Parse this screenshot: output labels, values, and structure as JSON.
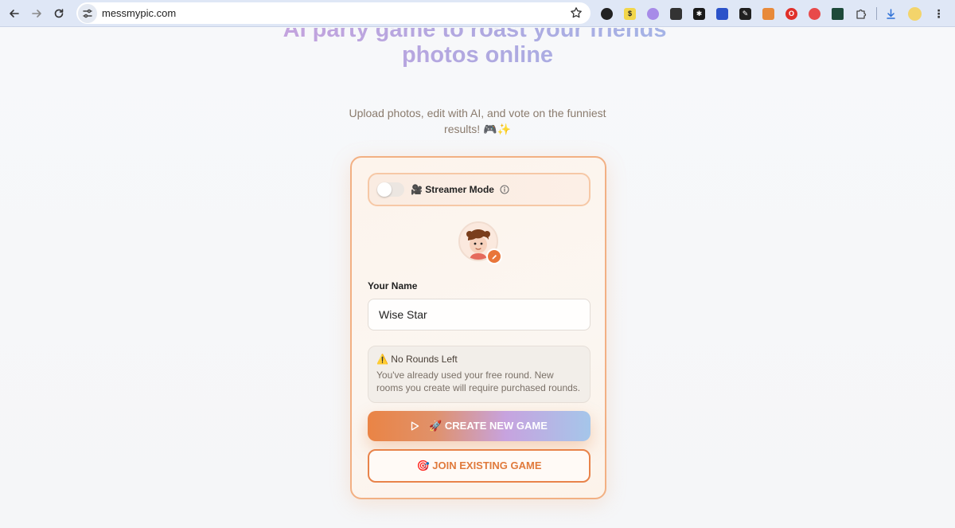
{
  "browser": {
    "url": "messmypic.com",
    "extensions": [
      {
        "icon": "ext-dark-circle-icon",
        "color": "#222222"
      },
      {
        "icon": "ext-dollar-icon",
        "color": "#f2d64b"
      },
      {
        "icon": "ext-cloud-icon",
        "color": "#a78be8"
      },
      {
        "icon": "ext-gift-icon",
        "color": "#333333"
      },
      {
        "icon": "ext-star-icon",
        "color": "#1a1a1a"
      },
      {
        "icon": "ext-blue-box-icon",
        "color": "#2b52c9"
      },
      {
        "icon": "ext-pencil-icon",
        "color": "#202020"
      },
      {
        "icon": "ext-fox-icon",
        "color": "#e88a3a"
      },
      {
        "icon": "ext-opera-icon",
        "color": "#e0302a"
      },
      {
        "icon": "ext-record-icon",
        "color": "#e84a4a"
      },
      {
        "icon": "ext-green-square-icon",
        "color": "#1e4a3a"
      },
      {
        "icon": "puzzle-icon",
        "color": "#444444"
      }
    ]
  },
  "hero": {
    "title": "AI party game to roast your friends' photos online",
    "subtitle": "Upload photos, edit with AI, and vote on the funniest results! 🎮✨"
  },
  "card": {
    "streamer_mode_label": "🎥 Streamer Mode",
    "name_label": "Your Name",
    "name_value": "Wise Star",
    "notice_title": "⚠️ No Rounds Left",
    "notice_text": "You've already used your free round. New rooms you create will require purchased rounds.",
    "create_button": "🚀 CREATE NEW GAME",
    "join_button": "🎯 JOIN EXISTING GAME"
  }
}
